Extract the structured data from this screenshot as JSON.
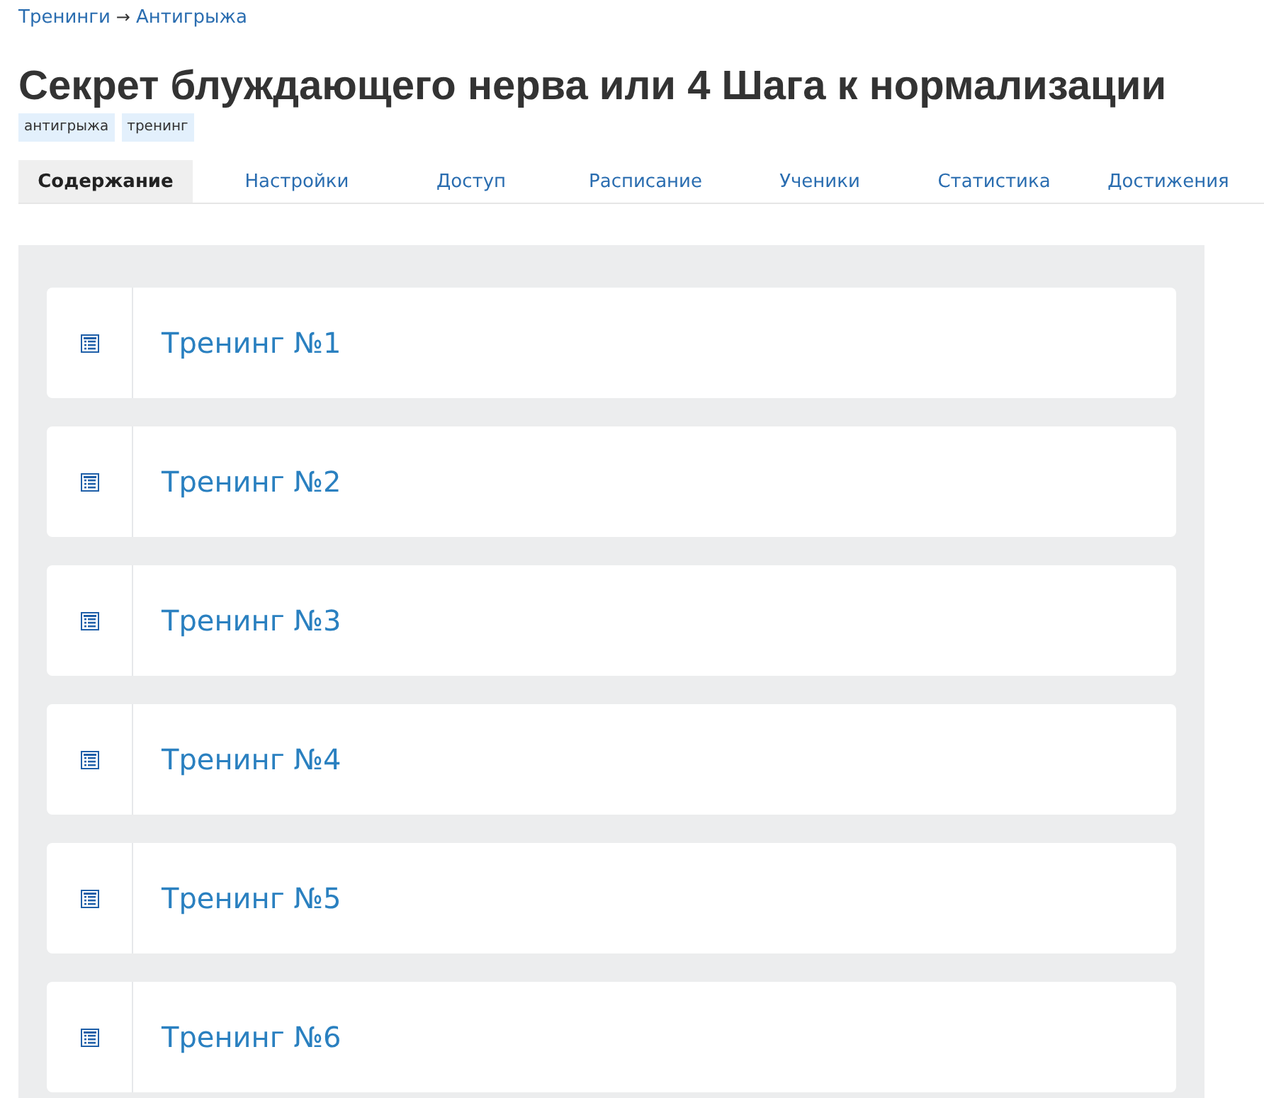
{
  "breadcrumb": {
    "parent": "Тренинги",
    "separator": "→",
    "current": "Антигрыжа"
  },
  "title": "Секрет блуждающего нерва или 4 Шага к нормализации",
  "tags": [
    "антигрыжа",
    "тренинг"
  ],
  "tabs": [
    {
      "label": "Содержание",
      "selected": true
    },
    {
      "label": "Настройки",
      "selected": false
    },
    {
      "label": "Доступ",
      "selected": false
    },
    {
      "label": "Расписание",
      "selected": false
    },
    {
      "label": "Ученики",
      "selected": false
    },
    {
      "label": "Статистика",
      "selected": false
    },
    {
      "label": "Достижения",
      "selected": false
    }
  ],
  "lessons": [
    {
      "title": "Тренинг №1"
    },
    {
      "title": "Тренинг №2"
    },
    {
      "title": "Тренинг №3"
    },
    {
      "title": "Тренинг №4"
    },
    {
      "title": "Тренинг №5"
    },
    {
      "title": "Тренинг №6"
    }
  ]
}
